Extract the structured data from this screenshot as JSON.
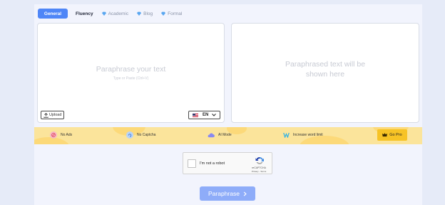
{
  "tabs": [
    {
      "label": "General"
    },
    {
      "label": "Fluency"
    },
    {
      "label": "Academic"
    },
    {
      "label": "Blog"
    },
    {
      "label": "Formal"
    }
  ],
  "input": {
    "placeholder_title": "Paraphrase your text",
    "placeholder_sub": "Type or Paste (Ctrl+V)",
    "upload_label": "Upload",
    "language": "EN"
  },
  "output": {
    "placeholder_line1": "Paraphrased text will be",
    "placeholder_line2": "shown here"
  },
  "promo": {
    "perks": [
      {
        "label": "No Ads"
      },
      {
        "label": "No Captcha"
      },
      {
        "label": "AI Mode"
      },
      {
        "label": "Increase word limit"
      }
    ],
    "cta": "Go Pro"
  },
  "captcha": {
    "label": "I'm not a robot",
    "brand": "reCAPTCHA",
    "terms": "Privacy - Terms"
  },
  "action": {
    "label": "Paraphrase"
  },
  "colors": {
    "accent": "#4f86f7",
    "premium_gem": "#5aa7f0",
    "promo_bg": "#fbe49b",
    "cta": "#f7c325"
  }
}
